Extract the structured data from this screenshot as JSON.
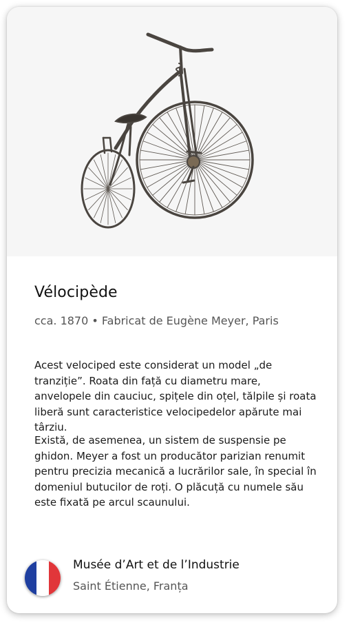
{
  "artifact": {
    "image_alt": "Velocipede photograph",
    "title": "Vélocipède",
    "subtitle": "cca. 1870 • Fabricat de Eugène Meyer, Paris",
    "description": [
      "Acest velociped este considerat un model „de tranziție”. Roata din față cu diametru mare, anvelopele din cauciuc, spițele din oțel, tălpile și roata liberă sunt caracteristice velocipedelor apărute mai târziu.",
      "Există, de asemenea, un sistem de suspensie pe ghidon. Meyer a fost un producător parizian renumit pentru precizia mecanică a lucrărilor sale, în special în domeniul butucilor de roți. O plăcuță cu numele său este fixată pe arcul scaunului."
    ]
  },
  "museum": {
    "name": "Musée d’Art et de l’Industrie",
    "location": "Saint Étienne, Franța",
    "flag_icon": "france-flag-icon",
    "flag_colors": [
      "#1f3fa0",
      "#ffffff",
      "#e1363a"
    ]
  },
  "colors": {
    "image_background": "#f6f6f6",
    "bicycle_metal": "#4a4540"
  }
}
